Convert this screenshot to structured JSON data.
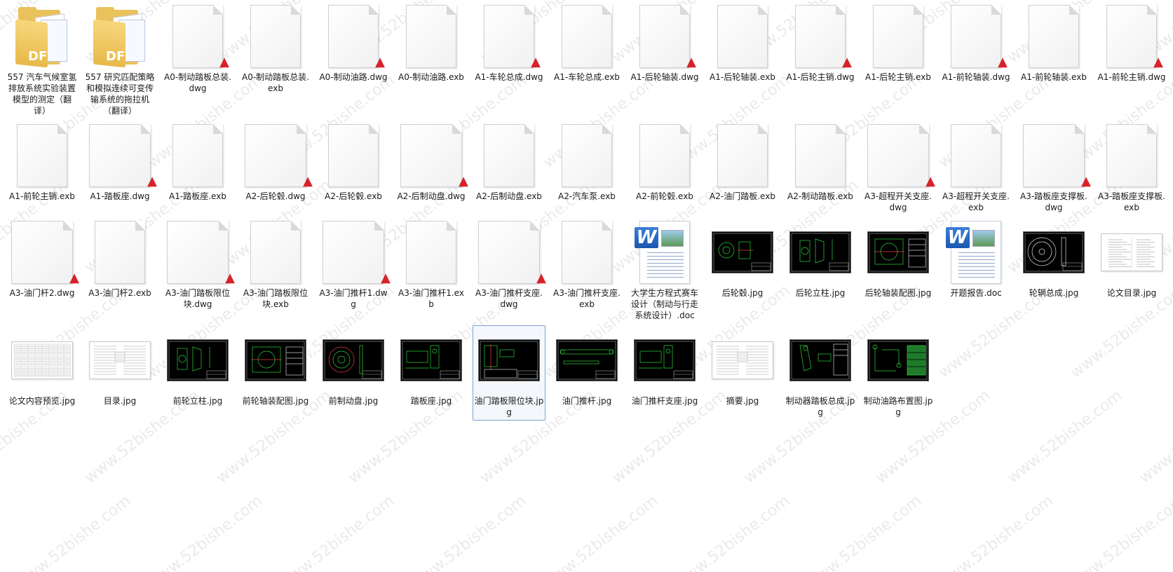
{
  "watermark": "www.52bishe.com",
  "colors": {
    "pdf_badge": "#d8222a",
    "cad_bg": "#000000",
    "cad_line": "#2fd13a",
    "selection_border": "#7da2ce"
  },
  "items": [
    {
      "label": "557 汽车气候室氢排放系统实验装置模型的测定（翻译）",
      "icon": "pdf-folder-icon",
      "type": "folder"
    },
    {
      "label": "557 研究匹配策略和模拟连续可变传输系统的拖拉机（翻译）",
      "icon": "pdf-folder-icon",
      "type": "folder"
    },
    {
      "label": "A0-制动踏板总装.dwg",
      "icon": "dwg-file-icon",
      "type": "dwg"
    },
    {
      "label": "A0-制动踏板总装.exb",
      "icon": "blank-file-icon",
      "type": "exb"
    },
    {
      "label": "A0-制动油路.dwg",
      "icon": "dwg-file-icon",
      "type": "dwg"
    },
    {
      "label": "A0-制动油路.exb",
      "icon": "blank-file-icon",
      "type": "exb"
    },
    {
      "label": "A1-车轮总成.dwg",
      "icon": "dwg-file-icon",
      "type": "dwg"
    },
    {
      "label": "A1-车轮总成.exb",
      "icon": "blank-file-icon",
      "type": "exb"
    },
    {
      "label": "A1-后轮轴装.dwg",
      "icon": "dwg-file-icon",
      "type": "dwg"
    },
    {
      "label": "A1-后轮轴装.exb",
      "icon": "blank-file-icon",
      "type": "exb"
    },
    {
      "label": "A1-后轮主销.dwg",
      "icon": "dwg-file-icon",
      "type": "dwg"
    },
    {
      "label": "A1-后轮主销.exb",
      "icon": "blank-file-icon",
      "type": "exb"
    },
    {
      "label": "A1-前轮轴装.dwg",
      "icon": "dwg-file-icon",
      "type": "dwg"
    },
    {
      "label": "A1-前轮轴装.exb",
      "icon": "blank-file-icon",
      "type": "exb"
    },
    {
      "label": "A1-前轮主销.dwg",
      "icon": "dwg-file-icon",
      "type": "dwg"
    },
    {
      "label": "A1-前轮主销.exb",
      "icon": "blank-file-icon",
      "type": "exb"
    },
    {
      "label": "A1-踏板座.dwg",
      "icon": "dwg-file-icon",
      "type": "dwg-wide"
    },
    {
      "label": "A1-踏板座.exb",
      "icon": "blank-file-icon",
      "type": "exb"
    },
    {
      "label": "A2-后轮毂.dwg",
      "icon": "dwg-file-icon",
      "type": "dwg-wide"
    },
    {
      "label": "A2-后轮毂.exb",
      "icon": "blank-file-icon",
      "type": "exb"
    },
    {
      "label": "A2-后制动盘.dwg",
      "icon": "dwg-file-icon",
      "type": "dwg-wide"
    },
    {
      "label": "A2-后制动盘.exb",
      "icon": "blank-file-icon",
      "type": "exb"
    },
    {
      "label": "A2-汽车泵.exb",
      "icon": "blank-file-icon",
      "type": "exb"
    },
    {
      "label": "A2-前轮毂.exb",
      "icon": "blank-file-icon",
      "type": "exb"
    },
    {
      "label": "A2-油门踏板.exb",
      "icon": "blank-file-icon",
      "type": "exb"
    },
    {
      "label": "A2-制动踏板.exb",
      "icon": "blank-file-icon",
      "type": "exb"
    },
    {
      "label": "A3-超程开关支座.dwg",
      "icon": "dwg-file-icon",
      "type": "dwg-wide"
    },
    {
      "label": "A3-超程开关支座.exb",
      "icon": "blank-file-icon",
      "type": "exb"
    },
    {
      "label": "A3-踏板座支撑板.dwg",
      "icon": "dwg-file-icon",
      "type": "dwg-wide"
    },
    {
      "label": "A3-踏板座支撑板.exb",
      "icon": "blank-file-icon",
      "type": "exb"
    },
    {
      "label": "A3-油门杆2.dwg",
      "icon": "dwg-file-icon",
      "type": "dwg-wide"
    },
    {
      "label": "A3-油门杆2.exb",
      "icon": "blank-file-icon",
      "type": "exb"
    },
    {
      "label": "A3-油门踏板限位块.dwg",
      "icon": "dwg-file-icon",
      "type": "dwg-wide"
    },
    {
      "label": "A3-油门踏板限位块.exb",
      "icon": "blank-file-icon",
      "type": "exb"
    },
    {
      "label": "A3-油门推杆1.dwg",
      "icon": "dwg-file-icon",
      "type": "dwg-wide"
    },
    {
      "label": "A3-油门推杆1.exb",
      "icon": "blank-file-icon",
      "type": "exb"
    },
    {
      "label": "A3-油门推杆支座.dwg",
      "icon": "dwg-file-icon",
      "type": "dwg-wide"
    },
    {
      "label": "A3-油门推杆支座.exb",
      "icon": "blank-file-icon",
      "type": "exb"
    },
    {
      "label": "大学生方程式赛车设计（制动与行走系统设计）.doc",
      "icon": "word-doc-icon",
      "type": "word"
    },
    {
      "label": "后轮毂.jpg",
      "icon": "cad-image-icon",
      "type": "cad",
      "art": "hub"
    },
    {
      "label": "后轮立柱.jpg",
      "icon": "cad-image-icon",
      "type": "cad",
      "art": "upright"
    },
    {
      "label": "后轮轴装配图.jpg",
      "icon": "cad-image-icon",
      "type": "cad",
      "art": "assembly"
    },
    {
      "label": "开题报告.doc",
      "icon": "word-doc-icon",
      "type": "word"
    },
    {
      "label": "轮辋总成.jpg",
      "icon": "cad-image-icon",
      "type": "cad",
      "art": "rim"
    },
    {
      "label": "论文目录.jpg",
      "icon": "text-image-icon",
      "type": "paper",
      "art": "toc"
    },
    {
      "label": "论文内容预览.jpg",
      "icon": "text-image-icon",
      "type": "paper",
      "art": "grid"
    },
    {
      "label": "目录.jpg",
      "icon": "text-image-icon",
      "type": "paper",
      "art": "text"
    },
    {
      "label": "前轮立柱.jpg",
      "icon": "cad-image-icon",
      "type": "cad",
      "art": "upright"
    },
    {
      "label": "前轮轴装配图.jpg",
      "icon": "cad-image-icon",
      "type": "cad",
      "art": "assembly"
    },
    {
      "label": "前制动盘.jpg",
      "icon": "cad-image-icon",
      "type": "cad",
      "art": "disc"
    },
    {
      "label": "踏板座.jpg",
      "icon": "cad-image-icon",
      "type": "cad",
      "art": "seat"
    },
    {
      "label": "油门踏板限位块.jpg",
      "icon": "cad-image-icon",
      "type": "cad",
      "art": "block",
      "selected": true
    },
    {
      "label": "油门推杆.jpg",
      "icon": "cad-image-icon",
      "type": "cad",
      "art": "rod"
    },
    {
      "label": "油门推杆支座.jpg",
      "icon": "cad-image-icon",
      "type": "cad",
      "art": "seat"
    },
    {
      "label": "摘要.jpg",
      "icon": "text-image-icon",
      "type": "paper",
      "art": "text"
    },
    {
      "label": "制动器踏板总成.jpg",
      "icon": "cad-image-icon",
      "type": "cad",
      "art": "pedal"
    },
    {
      "label": "制动油路布置图.jpg",
      "icon": "cad-image-icon",
      "type": "cad",
      "art": "layout"
    }
  ]
}
